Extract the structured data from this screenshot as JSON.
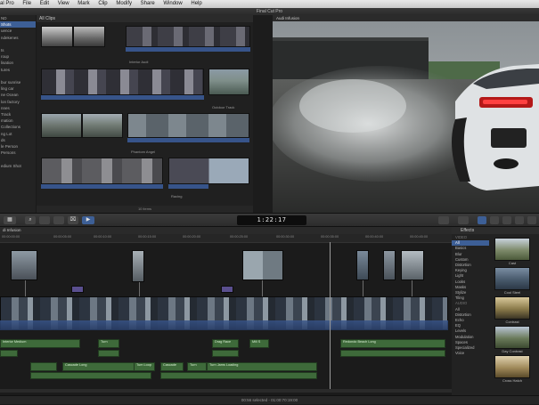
{
  "menubar": {
    "items": [
      "al Pro",
      "File",
      "Edit",
      "View",
      "Mark",
      "Clip",
      "Modify",
      "Share",
      "Window",
      "Help"
    ]
  },
  "window_title": "Final Cut Pro",
  "library": {
    "items": [
      "ND",
      "Shots",
      "uence",
      "ndekenes",
      "",
      "ts",
      "roup",
      "lisation",
      "tures",
      "",
      "bur sunrise",
      "ling car",
      "ne Ocean",
      "lon factory",
      "nnes",
      "Track",
      "mation",
      "Collections",
      "ng Lot",
      "ds",
      "le Person",
      "Persons",
      "",
      "edium Shot"
    ],
    "selected_index": 1
  },
  "browser": {
    "title": "All Clips",
    "footer": "10 items",
    "labels": {
      "interior": "Interior Audi",
      "outdoor": "Outdoor Track",
      "phantom": "Phantom Angel",
      "racing": "Racing"
    }
  },
  "viewer": {
    "title": "Audi Infusion"
  },
  "toolbar": {
    "timecode": "1:22:17",
    "buttons": [
      "▦",
      "⌕",
      "⌧",
      "▶"
    ]
  },
  "timeline": {
    "title": "di Infusion",
    "ruler": [
      "00:00:00:00",
      "00:00:05:00",
      "00:00:10:00",
      "00:00:15:00",
      "00:00:20:00",
      "00:00:25:00",
      "00:00:30:00",
      "00:00:35:00",
      "00:00:40:00",
      "00:00:45:00",
      "00:00:50:00"
    ],
    "audio_labels": [
      "Interior Medium",
      "Turn",
      "Drag Race",
      "Mill S",
      "Redondo Beach Long",
      "Cascade Long",
      "Tum Loop",
      "Cascade",
      "Turn",
      "Turn Jams Loading"
    ],
    "footer": "00:56 selected - 01:00:70:19:00"
  },
  "effects": {
    "title": "Effects",
    "categories": [
      "VIDEO",
      "All",
      "Basics",
      "Blur",
      "Custom",
      "Distortion",
      "Keying",
      "Light",
      "Looks",
      "Masks",
      "Stylize",
      "Tiling",
      "AUDIO",
      "All",
      "Distortion",
      "Echo",
      "EQ",
      "Levels",
      "Modulation",
      "Spaces",
      "Specialized",
      "Voice"
    ],
    "selected_index": 1,
    "items": [
      "Cast",
      "Cool Steel",
      "Contrast",
      "Day Contrast",
      "Cross Hatch"
    ]
  },
  "colors": {
    "accent": "#3d5f96",
    "audio": "#3e6a3a",
    "video_bar": "#37548a"
  }
}
